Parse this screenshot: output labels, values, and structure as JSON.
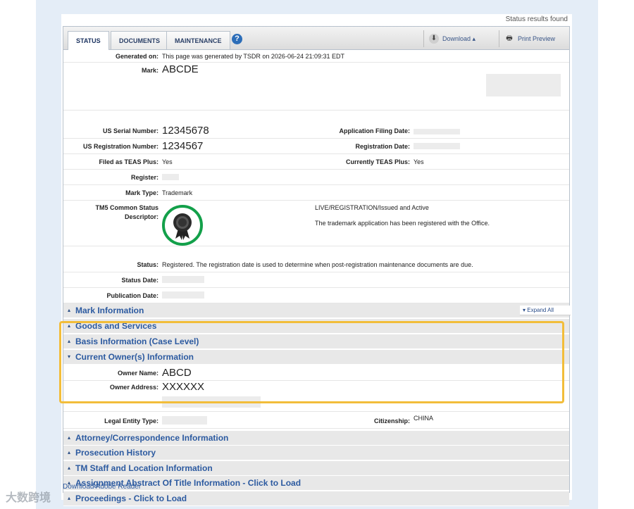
{
  "status_found": "Status results found",
  "tabs": [
    {
      "label": "STATUS",
      "active": true
    },
    {
      "label": "DOCUMENTS",
      "active": false
    },
    {
      "label": "MAINTENANCE",
      "active": false
    }
  ],
  "toolbar": {
    "help": "?",
    "download": "Download ▴",
    "print": "Print Preview"
  },
  "fields": {
    "generated_on": {
      "label": "Generated on:",
      "value": "This page was generated by TSDR on 2026-06-24 21:09:31 EDT"
    },
    "mark": {
      "label": "Mark:",
      "value": "ABCDE"
    },
    "serial": {
      "label": "US Serial Number:",
      "value": "12345678"
    },
    "filing_date": {
      "label": "Application Filing Date:",
      "value": ""
    },
    "registration_number": {
      "label": "US Registration Number:",
      "value": "1234567"
    },
    "registration_date": {
      "label": "Registration Date:",
      "value": ""
    },
    "teas_plus": {
      "label": "Filed as TEAS Plus:",
      "value": "Yes"
    },
    "currently_teas": {
      "label": "Currently TEAS Plus:",
      "value": "Yes"
    },
    "register": {
      "label": "Register:",
      "value": ""
    },
    "mark_type": {
      "label": "Mark Type:",
      "value": "Trademark"
    },
    "tm5": {
      "label": "TM5 Common Status Descriptor:",
      "line1": "LIVE/REGISTRATION/Issued and Active",
      "line2": "The trademark application has been registered with the Office."
    },
    "status": {
      "label": "Status:",
      "value": "Registered. The registration date is used to determine when post-registration maintenance documents are due."
    },
    "status_date": {
      "label": "Status Date:",
      "value": ""
    },
    "publication_date": {
      "label": "Publication Date:",
      "value": ""
    }
  },
  "expand_all": "▾ Expand All",
  "sections": [
    {
      "title": "Mark Information",
      "arrow": "▴"
    },
    {
      "title": "Goods and Services",
      "arrow": "▴"
    },
    {
      "title": "Basis Information (Case Level)",
      "arrow": "▴"
    },
    {
      "title": "Current Owner(s) Information",
      "arrow": "▾"
    }
  ],
  "owner": {
    "name_label": "Owner Name:",
    "name": "ABCD",
    "address_label": "Owner Address:",
    "address": "XXXXXX",
    "entity_label": "Legal Entity Type:",
    "entity": "",
    "citizenship_label": "Citizenship:",
    "citizenship": "CHINA"
  },
  "sections_after": [
    {
      "title": "Attorney/Correspondence Information",
      "arrow": "▴"
    },
    {
      "title": "Prosecution History",
      "arrow": "▴"
    },
    {
      "title": "TM Staff and Location Information",
      "arrow": "▴"
    },
    {
      "title": "Assignment Abstract Of Title Information - Click to Load",
      "arrow": "▴"
    },
    {
      "title": "Proceedings - Click to Load",
      "arrow": "▴"
    }
  ],
  "adobe_link": "Download Adobe Reader",
  "watermark": "大数跨境"
}
